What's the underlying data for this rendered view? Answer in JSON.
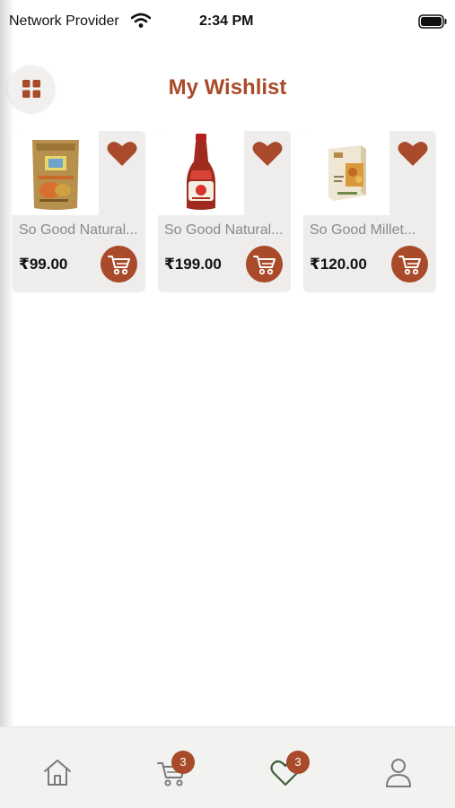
{
  "status_bar": {
    "carrier": "Network Provider",
    "time": "2:34 PM"
  },
  "header": {
    "title": "My Wishlist",
    "menu_icon": "grid-icon"
  },
  "colors": {
    "accent": "#a94a2a",
    "card_bg": "#eeedeb",
    "tab_bar_bg": "#f2f2f1"
  },
  "products": [
    {
      "name": "So Good Natural...",
      "price": "₹99.00"
    },
    {
      "name": "So Good Natural...",
      "price": "₹199.00"
    },
    {
      "name": "So Good Millet...",
      "price": "₹120.00"
    }
  ],
  "tab_bar": {
    "items": [
      {
        "icon": "home-icon"
      },
      {
        "icon": "cart-icon",
        "badge": "3"
      },
      {
        "icon": "heart-icon",
        "badge": "3"
      },
      {
        "icon": "profile-icon"
      }
    ]
  }
}
